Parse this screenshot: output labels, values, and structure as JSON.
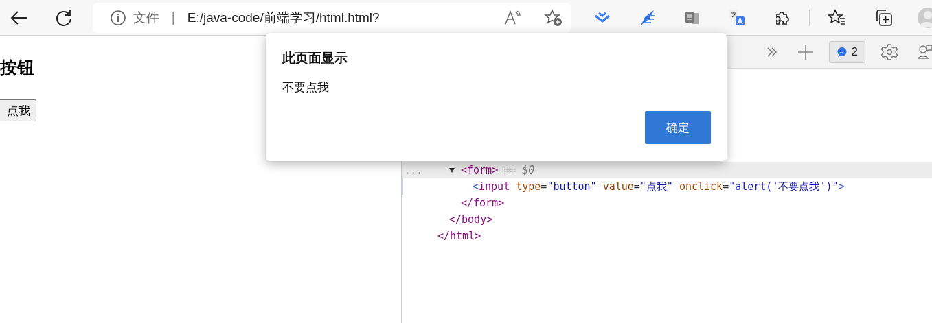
{
  "address_bar": {
    "security_label": "文件",
    "separator": "|",
    "url": "E:/java-code/前端学习/html.html?"
  },
  "page": {
    "heading": "按钮",
    "button": "点我"
  },
  "devtools": {
    "issues_count": "2",
    "elements": [
      {
        "close": "</html>",
        "children": [
          {
            "close": "</body>",
            "children": [
              {
                "open": [
                  {
                    "kind": "tag",
                    "text": "<form>"
                  }
                ],
                "marker": "== $0",
                "dots": "...",
                "expanded": true,
                "selected": true,
                "close": "</form>",
                "children": [
                  {
                    "open": [
                      {
                        "kind": "bracket",
                        "text": "<"
                      },
                      {
                        "kind": "tag",
                        "text": "input"
                      },
                      {
                        "kind": "attr",
                        "text": " type"
                      },
                      {
                        "kind": "plain",
                        "text": "="
                      },
                      {
                        "kind": "value",
                        "text": "\"button\""
                      },
                      {
                        "kind": "attr",
                        "text": " value"
                      },
                      {
                        "kind": "plain",
                        "text": "="
                      },
                      {
                        "kind": "value",
                        "text": "\"点我\""
                      },
                      {
                        "kind": "attr",
                        "text": " onclick"
                      },
                      {
                        "kind": "plain",
                        "text": "="
                      },
                      {
                        "kind": "value",
                        "text": "\"alert('不要点我')\""
                      },
                      {
                        "kind": "bracket",
                        "text": ">"
                      }
                    ],
                    "selected": false
                  }
                ]
              }
            ]
          }
        ]
      }
    ]
  },
  "dialog": {
    "title": "此页面显示",
    "message": "不要点我",
    "ok_button": "确定"
  }
}
